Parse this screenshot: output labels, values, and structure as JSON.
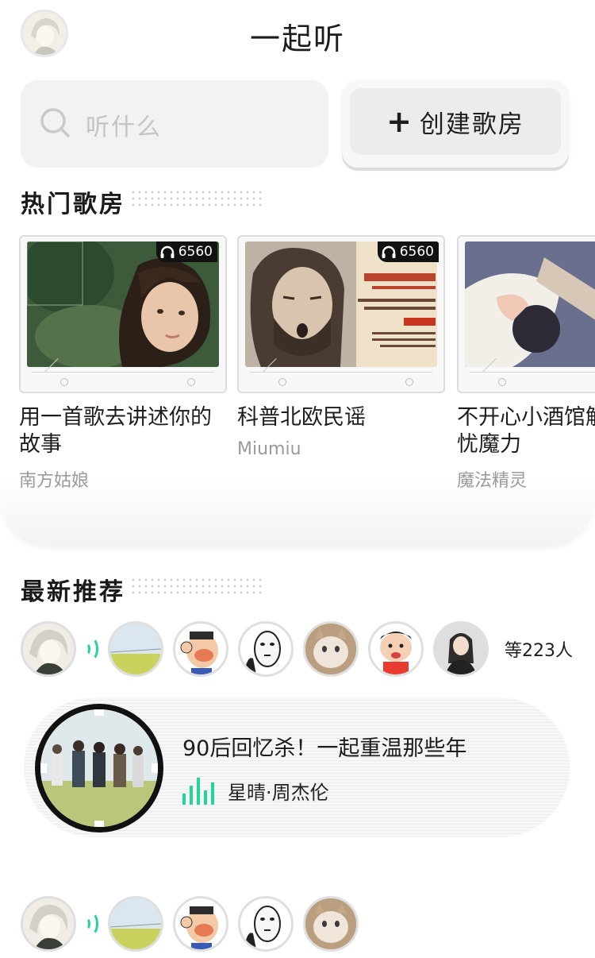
{
  "header": {
    "title": "一起听",
    "avatar_icon": "user-avatar"
  },
  "search": {
    "placeholder": "听什么"
  },
  "create_button": {
    "label": "创建歌房"
  },
  "hot_section": {
    "title": "热门歌房",
    "rooms": [
      {
        "name": "用一首歌去讲述你的故事",
        "author": "南方姑娘",
        "listeners": "6560",
        "cover": "girl-portrait"
      },
      {
        "name": "科普北欧民谣",
        "author": "Miumiu",
        "listeners": "6560",
        "cover": "man-poster"
      },
      {
        "name": "不开心小酒馆解忧魔力",
        "author": "魔法精灵",
        "listeners": "",
        "cover": "guitar-photo"
      }
    ]
  },
  "new_section": {
    "title": "最新推荐",
    "count_text": "等223人",
    "recommendation": {
      "title": "90后回忆杀！一起重温那些年",
      "song": "星晴·周杰伦"
    }
  },
  "colors": {
    "accent": "#22d39a",
    "text": "#1e1e1e",
    "muted": "#9a9a9a"
  }
}
